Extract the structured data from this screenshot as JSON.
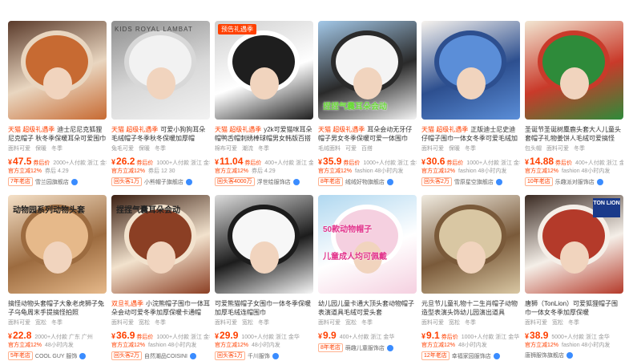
{
  "products": [
    {
      "promo": "",
      "overlay": "",
      "title_tag": "天猫 超级礼遇季",
      "title_text": "迪士尼尼克狐狸尼克帽子 秋冬季保暖耳朵可爱围巾一体帽",
      "specs": [
        "面料可爱",
        "保暖",
        "冬季"
      ],
      "price": "47.5",
      "price_note": "券后价",
      "meta": "2000+人付款 浙江 金华",
      "discount1": "官方立减12%",
      "discount2": "券后 4.29",
      "badge": "7年老店",
      "shop": "雪兰园旗舰店",
      "colors": [
        "#c76a32",
        "#e9d6c0",
        "#5a3a2a"
      ]
    },
    {
      "promo": "",
      "overlay": "",
      "corner": "KIDS ROYAL LAMBAT",
      "title_tag": "天猫 超级礼遇季",
      "title_text": "可爱小狗狗耳朵毛绒帽子冬季秋冬保暖加厚帽",
      "specs": [
        "兔毛可爱",
        "保暖",
        "冬季"
      ],
      "price": "26.2",
      "price_note": "券后价",
      "meta": "1000+人付款 浙江 金华",
      "discount1": "官方立减12%",
      "discount2": "券后 12 30",
      "badge": "回头客1万",
      "shop": "小熊帽子旗舰店",
      "colors": [
        "#f2f2f2",
        "#d8d8d8",
        "#8e8e8e"
      ]
    },
    {
      "promo": "预告礼遇季",
      "overlay": "",
      "title_tag": "天猫 超级礼遇季",
      "title_text": "y2k可爱猫咪耳朵帽鸭舌帽刺绣棒球帽男女韩版百搭",
      "specs": [
        "棉布可爱",
        "潮流",
        "冬季"
      ],
      "price": "11.04",
      "price_note": "券后价",
      "meta": "400+人付款 浙江 金华",
      "discount1": "官方立减12%",
      "discount2": "券后 4.29",
      "badge": "回头客4000万",
      "shop": "浮世绘服饰店",
      "colors": [
        "#1e1e1e",
        "#ffffff",
        "#cfcfcf"
      ]
    },
    {
      "promo": "",
      "overlay": "捏捏气囊耳朵会动",
      "title_tag": "天猫 超级礼遇季",
      "title_text": "耳朵会动无牙仔帽子男女冬季保暖可爱一体围巾",
      "specs": [
        "毛绒面料",
        "可爱",
        "百搭"
      ],
      "price": "35.9",
      "price_note": "券后价",
      "meta": "1000+人付款 浙江 金华",
      "discount1": "官方立减12%",
      "discount2": "fashion 48小时内发",
      "badge": "8年老店",
      "shop": "绒绒好物旗舰店",
      "colors": [
        "#f4f4f4",
        "#2a2a2a",
        "#a3c8e8"
      ]
    },
    {
      "promo": "",
      "overlay": "",
      "title_tag": "天猫 超级礼遇季",
      "title_text": "正版迪士尼史迪仔帽子围巾一体女冬季可爱毛绒加厚保暖",
      "specs": [
        "面料可爱",
        "保暖",
        "冬季"
      ],
      "price": "30.6",
      "price_note": "券后价",
      "meta": "1000+人付款 浙江 金华",
      "discount1": "官方立减12%",
      "discount2": "fashion 48小时内发",
      "badge": "回头客2万",
      "shop": "雪原星空旗舰店",
      "colors": [
        "#5b8ed8",
        "#2d4f8f",
        "#f7f3ee"
      ]
    },
    {
      "promo": "",
      "overlay": "",
      "title_tag": "",
      "title_text": "圣诞节圣诞树麋鹿头套大人儿童头套帽子礼物姜饼人毛绒可爱搞怪",
      "specs": [
        "包头帽",
        "面料可爱",
        "冬季"
      ],
      "price": "14.88",
      "price_note": "券后价",
      "meta": "400+人付款 浙江 金华",
      "discount1": "官方立减12%",
      "discount2": "fashion 48小时内发",
      "badge": "10年老店",
      "shop": "乐趣派对服饰店",
      "colors": [
        "#2e8b3a",
        "#c93a2a",
        "#f2e6d2"
      ]
    },
    {
      "promo": "",
      "overlay": "动物园系列动物头套",
      "title_tag": "",
      "title_text": "搞怪动物头套帽子大象老虎狮子兔子乌龟周末手提搞怪拍照",
      "specs": [
        "面料可爱",
        "宽松",
        "冬季"
      ],
      "price": "22.8",
      "price_note": "",
      "meta": "2000+人付款 广东 广州",
      "discount1": "官方立减12%",
      "discount2": "48小时内发",
      "badge": "5年老店",
      "shop": "COOL GUY 服饰",
      "colors": [
        "#e6b98a",
        "#9c6b3f",
        "#f5e1c8"
      ]
    },
    {
      "promo": "",
      "overlay": "捏捏气囊耳朵会动",
      "title_tag": "双旦礼遇季",
      "title_text": "小浣熊帽子围巾一体耳朵会动可爱冬季加厚保暖卡通帽",
      "specs": [
        "面料可爱",
        "宽松",
        "冬季"
      ],
      "price": "36.9",
      "price_note": "券后价",
      "meta": "1000+人付款 浙江 金华",
      "discount1": "官方立减12%",
      "discount2": "fashion 48小时内发",
      "badge": "回头客2万",
      "shop": "自然潮品COISINI",
      "colors": [
        "#8b3f24",
        "#f2e2cd",
        "#3b1f12"
      ]
    },
    {
      "promo": "",
      "overlay": "",
      "title_tag": "",
      "title_text": "可爱熊猫帽子女围巾一体冬季保暖加厚毛绒连帽围巾",
      "specs": [
        "面料可爱",
        "宽松",
        "冬季"
      ],
      "price": "29.9",
      "price_note": "",
      "meta": "1000+人付款 浙江 金华",
      "discount1": "官方立减12%",
      "discount2": "48小时内发",
      "badge": "回头客1万",
      "shop": "千川服饰",
      "colors": [
        "#f7f7f7",
        "#1c1c1c",
        "#dcdcdc"
      ]
    },
    {
      "promo": "",
      "overlay": "儿童成人均可佩戴",
      "top_text": "50款动物帽子",
      "title_tag": "",
      "title_text": "幼儿园儿童卡通大顶头套动物帽子表演道具毛绒可爱头套",
      "specs": [
        "面料可爱",
        "宽松",
        "冬季"
      ],
      "price": "9.9",
      "price_note": "",
      "meta": "400+人付款 浙江 金华",
      "discount1": "",
      "discount2": "",
      "badge": "8年老店",
      "shop": "萌趣儿童服饰店",
      "colors": [
        "#f5d0e0",
        "#ffffff",
        "#b0d8f0"
      ]
    },
    {
      "promo": "",
      "overlay": "",
      "title_tag": "",
      "title_text": "元旦节儿童礼物十二生肖帽子动物造型表演头饰幼儿园演出道具",
      "specs": [
        "面料可爱",
        "宽松",
        "冬季"
      ],
      "price": "9.1",
      "price_note": "券后价",
      "meta": "1000+人付款 浙江 金华",
      "discount1": "官方立减12%",
      "discount2": "48小时内发",
      "badge": "12年老店",
      "shop": "幸福家园服饰店",
      "colors": [
        "#d9c7a3",
        "#7a5a3a",
        "#f0ebe0"
      ]
    },
    {
      "promo": "",
      "overlay": "",
      "brand": "TON LION",
      "title_tag": "",
      "title_text": "唐狮（TonLion）可爱狐狸帽子围巾一体女冬季加厚保暖",
      "specs": [
        "面料可爱",
        "宽松",
        "冬季"
      ],
      "price": "38.9",
      "price_note": "",
      "meta": "5000+人付款 浙江 金华",
      "discount1": "官方立减12%",
      "discount2": "fashion 48小时内发",
      "badge": "",
      "shop": "唐狮服饰旗舰店",
      "colors": [
        "#b43a2a",
        "#f5efe8",
        "#3a2a22"
      ]
    }
  ]
}
